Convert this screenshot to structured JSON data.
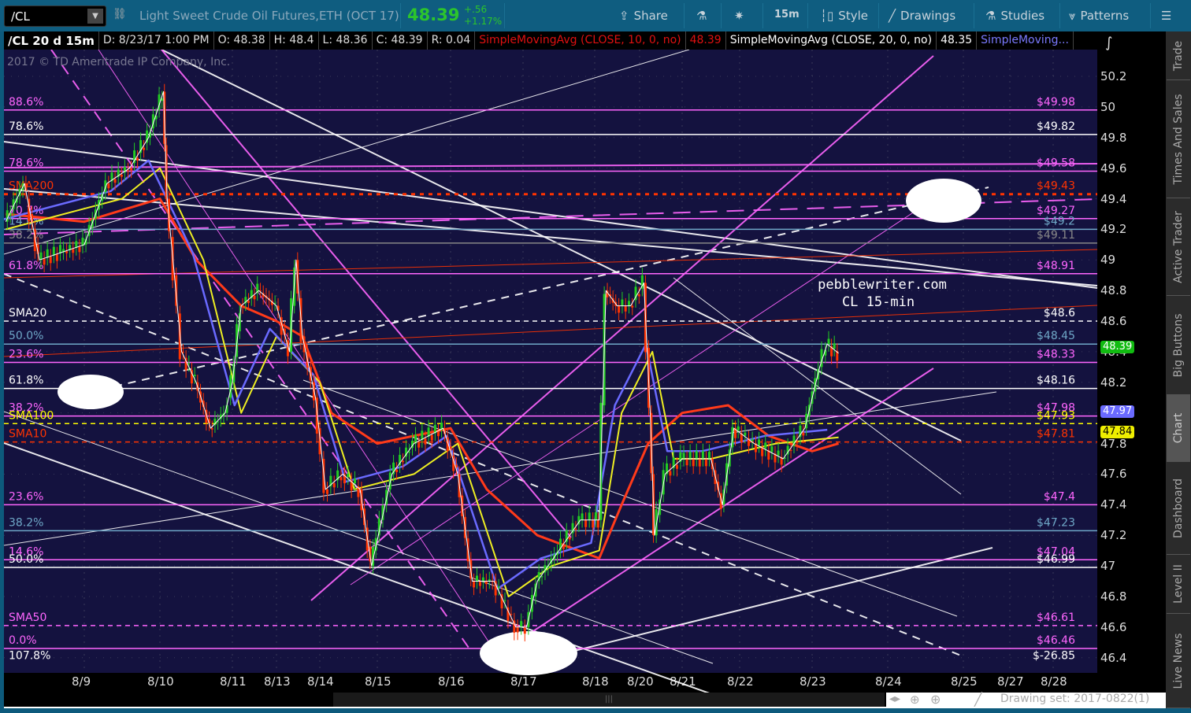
{
  "toolbar": {
    "symbol": "/CL",
    "description": "Light Sweet Crude Oil Futures,ETH (OCT 17)",
    "last": "48.39",
    "change": "+.56",
    "change_pct": "+1.17%",
    "share": "Share",
    "timeframe": "15m",
    "style": "Style",
    "drawings": "Drawings",
    "studies": "Studies",
    "patterns": "Patterns"
  },
  "info": {
    "title": "/CL 20 d 15m",
    "date": "D: 8/23/17 1:00 PM",
    "open": "O: 48.38",
    "high": "H: 48.4",
    "low": "L: 48.36",
    "close": "C: 48.39",
    "range": "R: 0.04",
    "sma10_label": "SimpleMovingAvg (CLOSE, 10, 0, no)",
    "sma10_val": "48.39",
    "sma20_label": "SimpleMovingAvg (CLOSE, 20, 0, no)",
    "sma20_val": "48.35",
    "sma_more": "SimpleMoving..."
  },
  "copyright": "2017 © TD Ameritrade IP Company, Inc.",
  "watermark": {
    "line1": "pebblewriter.com",
    "line2": "CL 15-min"
  },
  "badges": {
    "last": "48.39",
    "blue": "47.97",
    "yellow": "47.84"
  },
  "side_tabs": [
    "Trade",
    "Times And Sales",
    "Active Trader",
    "Big Buttons",
    "Chart",
    "Dashboard",
    "Level II",
    "Live News"
  ],
  "active_tab": "Chart",
  "drawing_set": "Drawing set: 2017-0822(1)",
  "colors": {
    "background": "#14123f",
    "up": "#22cc22",
    "down": "#ff3300",
    "magenta": "#ff66ff",
    "toolbar": "#0f5d80"
  },
  "chart_data": {
    "type": "candlestick-line",
    "title": "/CL 20 d 15m",
    "ylim": [
      46.3,
      50.35
    ],
    "y_ticks": [
      46.4,
      46.6,
      46.8,
      47,
      47.2,
      47.4,
      47.6,
      47.8,
      48,
      48.2,
      48.4,
      48.6,
      48.8,
      49,
      49.2,
      49.4,
      49.6,
      49.8,
      50,
      50.2
    ],
    "x_ticks": [
      "8/9",
      "8/10",
      "8/11",
      "8/13",
      "8/14",
      "8/15",
      "8/16",
      "8/17",
      "8/18",
      "8/20",
      "8/21",
      "8/22",
      "8/23",
      "8/24",
      "8/25",
      "8/27",
      "8/28"
    ],
    "levels": [
      {
        "price": 49.98,
        "color": "#ff66ff",
        "left": "88.6%",
        "right": "$49.98",
        "dash": false
      },
      {
        "price": 49.82,
        "color": "#ffffff",
        "left": "78.6%",
        "right": "$49.82",
        "dash": false
      },
      {
        "price": 49.58,
        "color": "#ff66ff",
        "left": "78.6%",
        "right": "$49.58",
        "dash": false
      },
      {
        "price": 49.43,
        "color": "#ff3300",
        "left": "SMA200",
        "right": "$49.43",
        "dash": "dot"
      },
      {
        "price": 49.27,
        "color": "#ff66ff",
        "left": "70.7%",
        "right": "$49.27",
        "dash": false
      },
      {
        "price": 49.2,
        "color": "#6fa8c8",
        "left": "14.6%",
        "right": "$49.2",
        "dash": false
      },
      {
        "price": 49.11,
        "color": "#888888",
        "left": "38.2%",
        "right": "$49.11",
        "dash": false
      },
      {
        "price": 48.91,
        "color": "#ff66ff",
        "left": "61.8%",
        "right": "$48.91",
        "dash": false
      },
      {
        "price": 48.6,
        "color": "#ffffff",
        "left": "SMA20",
        "right": "$48.6",
        "dash": "dash"
      },
      {
        "price": 48.45,
        "color": "#6fa8c8",
        "left": "50.0%",
        "right": "$48.45",
        "dash": false
      },
      {
        "price": 48.33,
        "color": "#ff66ff",
        "left": "23.6%",
        "right": "$48.33",
        "dash": false
      },
      {
        "price": 48.16,
        "color": "#ffffff",
        "left": "61.8%",
        "right": "$48.16",
        "dash": false
      },
      {
        "price": 47.98,
        "color": "#ff66ff",
        "left": "38.2%",
        "right": "$47.98",
        "dash": false
      },
      {
        "price": 47.93,
        "color": "#ffff00",
        "left": "SMA100",
        "right": "$47.93",
        "dash": "dash"
      },
      {
        "price": 47.81,
        "color": "#ff3300",
        "left": "SMA10",
        "right": "$47.81",
        "dash": "dash"
      },
      {
        "price": 47.4,
        "color": "#ff66ff",
        "left": "23.6%",
        "right": "$47.4",
        "dash": false
      },
      {
        "price": 47.23,
        "color": "#6fa8c8",
        "left": "38.2%",
        "right": "$47.23",
        "dash": false
      },
      {
        "price": 47.04,
        "color": "#ff66ff",
        "left": "14.6%",
        "right": "$47.04",
        "dash": false
      },
      {
        "price": 46.99,
        "color": "#ffffff",
        "left": "50.0%",
        "right": "$46.99",
        "dash": false
      },
      {
        "price": 46.61,
        "color": "#ff66ff",
        "left": "SMA50",
        "right": "$46.61",
        "dash": "dash"
      },
      {
        "price": 46.46,
        "color": "#ff66ff",
        "left": "0.0%",
        "right": "$46.46",
        "dash": false
      },
      {
        "price": 46.36,
        "color": "#ffffff",
        "left": "107.8%",
        "right": "$-26.85",
        "dash": "none"
      }
    ],
    "price_path": [
      [
        -1.05,
        49.25
      ],
      [
        -0.8,
        49.5
      ],
      [
        -0.6,
        49.0
      ],
      [
        -0.3,
        49.05
      ],
      [
        0,
        49.1
      ],
      [
        0.3,
        49.5
      ],
      [
        0.6,
        49.6
      ],
      [
        0.85,
        49.8
      ],
      [
        1.05,
        50.1
      ],
      [
        1.1,
        49.4
      ],
      [
        1.2,
        48.9
      ],
      [
        1.3,
        48.4
      ],
      [
        1.5,
        48.2
      ],
      [
        1.7,
        47.9
      ],
      [
        1.9,
        48.0
      ],
      [
        2.0,
        48.2
      ],
      [
        2.2,
        48.7
      ],
      [
        2.6,
        48.8
      ],
      [
        3.0,
        48.7
      ],
      [
        3.3,
        48.4
      ],
      [
        3.45,
        49.0
      ],
      [
        3.6,
        48.5
      ],
      [
        3.9,
        48.1
      ],
      [
        4.1,
        47.5
      ],
      [
        4.4,
        47.6
      ],
      [
        4.7,
        47.5
      ],
      [
        4.9,
        47.0
      ],
      [
        5.2,
        47.6
      ],
      [
        5.5,
        47.8
      ],
      [
        5.9,
        47.9
      ],
      [
        6.1,
        47.6
      ],
      [
        6.3,
        46.9
      ],
      [
        6.6,
        46.9
      ],
      [
        6.9,
        46.6
      ],
      [
        7.05,
        46.6
      ],
      [
        7.2,
        46.9
      ],
      [
        7.5,
        47.1
      ],
      [
        7.8,
        47.3
      ],
      [
        8.1,
        47.3
      ],
      [
        8.25,
        48.8
      ],
      [
        8.5,
        48.7
      ],
      [
        8.8,
        48.7
      ],
      [
        9.1,
        48.85
      ],
      [
        9.25,
        48.0
      ],
      [
        9.35,
        47.2
      ],
      [
        9.6,
        47.6
      ],
      [
        10.0,
        47.7
      ],
      [
        10.5,
        47.7
      ],
      [
        10.7,
        47.4
      ],
      [
        10.9,
        47.9
      ],
      [
        11.2,
        47.8
      ],
      [
        11.6,
        47.7
      ],
      [
        11.9,
        47.9
      ],
      [
        12.1,
        48.3
      ],
      [
        12.2,
        48.45
      ],
      [
        12.35,
        48.39
      ]
    ],
    "sma_slow": [
      [
        -1.05,
        49.3
      ],
      [
        0,
        49.25
      ],
      [
        1.0,
        49.4
      ],
      [
        1.5,
        49.0
      ],
      [
        2.2,
        48.7
      ],
      [
        3.0,
        48.6
      ],
      [
        3.6,
        48.5
      ],
      [
        4.2,
        48.0
      ],
      [
        5.0,
        47.8
      ],
      [
        6.0,
        47.9
      ],
      [
        6.5,
        47.5
      ],
      [
        7.2,
        47.2
      ],
      [
        8.1,
        47.05
      ],
      [
        8.6,
        47.4
      ],
      [
        9.2,
        47.8
      ],
      [
        10.0,
        48.0
      ],
      [
        10.8,
        48.05
      ],
      [
        11.4,
        47.85
      ],
      [
        12.0,
        47.75
      ],
      [
        12.35,
        47.8
      ]
    ],
    "sma_mid": [
      [
        -1.05,
        49.2
      ],
      [
        0.5,
        49.4
      ],
      [
        1.0,
        49.6
      ],
      [
        1.6,
        49.0
      ],
      [
        2.2,
        48.0
      ],
      [
        3.0,
        48.5
      ],
      [
        4.0,
        48.2
      ],
      [
        4.6,
        47.5
      ],
      [
        5.5,
        47.6
      ],
      [
        6.1,
        47.8
      ],
      [
        6.8,
        46.8
      ],
      [
        7.4,
        47.0
      ],
      [
        8.1,
        47.1
      ],
      [
        8.6,
        48.0
      ],
      [
        9.3,
        48.4
      ],
      [
        9.8,
        47.7
      ],
      [
        10.5,
        47.7
      ],
      [
        11.5,
        47.8
      ],
      [
        12.35,
        47.84
      ]
    ]
  }
}
